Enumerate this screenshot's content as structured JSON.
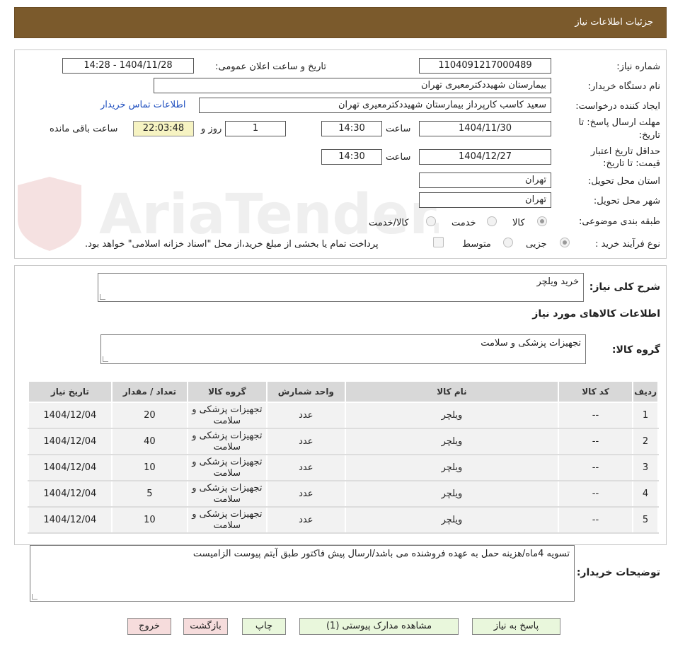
{
  "header": {
    "title": "جزئیات اطلاعات نیاز"
  },
  "watermark": {
    "text": "AriaTender.neT"
  },
  "form": {
    "need_number_label": "شماره نیاز:",
    "need_number": "1104091217000489",
    "announce_label": "تاریخ و ساعت اعلان عمومی:",
    "announce_value": "1404/11/28 - 14:28",
    "buyer_org_label": "نام دستگاه خریدار:",
    "buyer_org": "بیمارستان شهیددکترمعیری تهران",
    "creator_label": "ایجاد کننده درخواست:",
    "creator": "سعید کاسب کارپرداز بیمارستان شهیددکترمعیری تهران",
    "contact_link": "اطلاعات تماس خریدار",
    "deadline_label_1": "مهلت ارسال پاسخ: تا",
    "deadline_label_2": "تاریخ:",
    "deadline_date": "1404/11/30",
    "time_label": "ساعت",
    "deadline_time": "14:30",
    "days_value": "1",
    "days_label": "روز و",
    "remaining_time": "22:03:48",
    "remaining_label": "ساعت باقی مانده",
    "validity_label_1": "حداقل تاریخ اعتبار",
    "validity_label_2": "قیمت: تا تاریخ:",
    "validity_date": "1404/12/27",
    "validity_time": "14:30",
    "province_label": "استان محل تحویل:",
    "province": "تهران",
    "city_label": "شهر محل تحویل:",
    "city": "تهران",
    "category_label": "طبقه بندی موضوعی:",
    "category_options": [
      "کالا",
      "خدمت",
      "کالا/خدمت"
    ],
    "process_label": "نوع فرآیند خرید :",
    "process_options": [
      "جزیی",
      "متوسط"
    ],
    "payment_note": "پرداخت تمام یا بخشی از مبلغ خرید،از محل \"اسناد خزانه اسلامی\" خواهد بود."
  },
  "summary": {
    "label": "شرح کلی نیاز:",
    "value": "خرید ویلچر",
    "goods_info_title": "اطلاعات کالاهای مورد نیاز",
    "group_label": "گروه کالا:",
    "group_value": "تجهیزات پزشکی و سلامت"
  },
  "table": {
    "headers": [
      "ردیف",
      "کد کالا",
      "نام کالا",
      "واحد شمارش",
      "گروه کالا",
      "تعداد / مقدار",
      "تاریخ نیاز"
    ],
    "rows": [
      [
        "1",
        "--",
        "ویلچر",
        "عدد",
        "تجهیزات پزشکی و سلامت",
        "20",
        "1404/12/04"
      ],
      [
        "2",
        "--",
        "ویلچر",
        "عدد",
        "تجهیزات پزشکی و سلامت",
        "40",
        "1404/12/04"
      ],
      [
        "3",
        "--",
        "ویلچر",
        "عدد",
        "تجهیزات پزشکی و سلامت",
        "10",
        "1404/12/04"
      ],
      [
        "4",
        "--",
        "ویلچر",
        "عدد",
        "تجهیزات پزشکی و سلامت",
        "5",
        "1404/12/04"
      ],
      [
        "5",
        "--",
        "ویلچر",
        "عدد",
        "تجهیزات پزشکی و سلامت",
        "10",
        "1404/12/04"
      ]
    ]
  },
  "notes": {
    "label": "توضیحات خریدار:",
    "value": "تسویه 4ماه/هزینه حمل به عهده فروشنده می باشد/ارسال پیش فاکتور  طبق آیتم پیوست الزامیست"
  },
  "buttons": {
    "reply": "پاسخ به نیاز",
    "attachments": "مشاهده مدارک پیوستی (1)",
    "print": "چاپ",
    "back": "بازگشت",
    "exit": "خروج"
  }
}
